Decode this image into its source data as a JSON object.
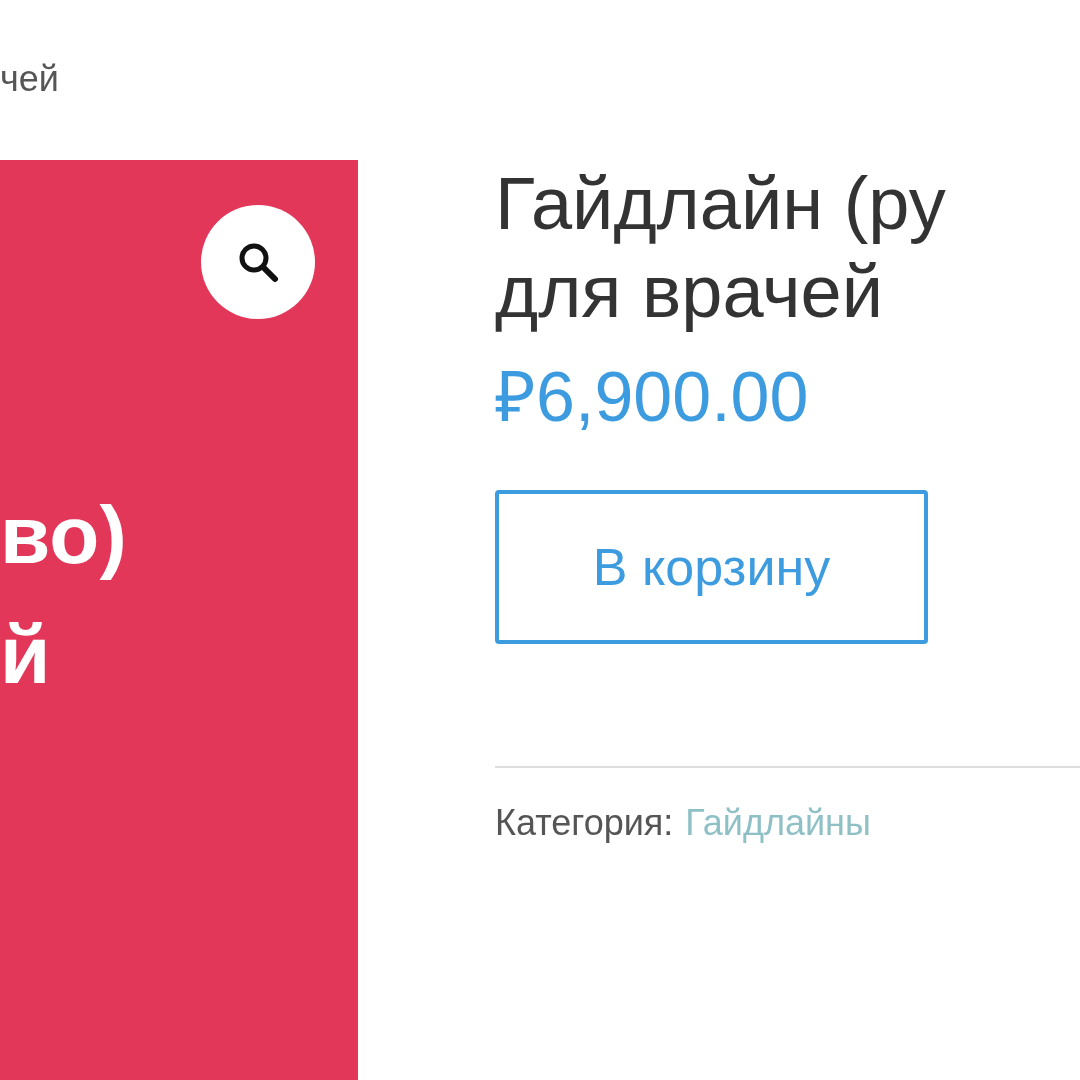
{
  "breadcrumb": "чей",
  "product_image": {
    "lines": [
      "во)",
      "й"
    ]
  },
  "product": {
    "title_lines": [
      "Гайдлайн (ру",
      "для врачей"
    ],
    "price": "₽6,900.00",
    "add_to_cart": "В корзину",
    "category_label": "Категория:",
    "category_link": "Гайдлайны"
  }
}
